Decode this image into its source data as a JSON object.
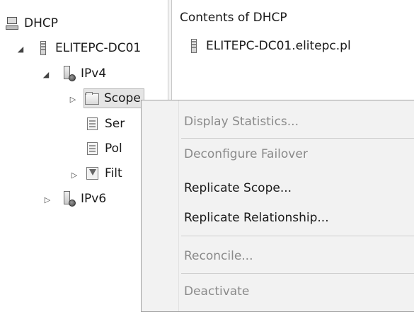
{
  "tree": {
    "root": {
      "label": "DHCP",
      "icon": "dhcp-icon"
    },
    "server": {
      "label": "ELITEPC-DC01",
      "icon": "server-icon",
      "expander": "◢"
    },
    "ipv4": {
      "label": "IPv4",
      "icon": "ipv4-icon",
      "expander": "◢"
    },
    "scope": {
      "label": "Scope",
      "icon": "folder-icon",
      "expander": "▷"
    },
    "server_options": {
      "label": "Ser",
      "icon": "server-options-icon"
    },
    "policies": {
      "label": "Pol",
      "icon": "policies-icon"
    },
    "filters": {
      "label": "Filt",
      "icon": "filter-icon",
      "expander": "▷"
    },
    "ipv6": {
      "label": "IPv6",
      "icon": "ipv6-icon",
      "expander": "▷"
    }
  },
  "content": {
    "header": "Contents of DHCP",
    "items": [
      {
        "label": "ELITEPC-DC01.elitepc.pl",
        "icon": "server-icon"
      }
    ]
  },
  "context_menu": {
    "items": [
      {
        "label": "Display Statistics...",
        "enabled": false
      },
      {
        "label": "Deconfigure Failover",
        "enabled": false
      },
      {
        "label": "Replicate Scope...",
        "enabled": true
      },
      {
        "label": "Replicate Relationship...",
        "enabled": true
      },
      {
        "label": "Reconcile...",
        "enabled": false
      },
      {
        "label": "Deactivate",
        "enabled": false
      }
    ]
  }
}
